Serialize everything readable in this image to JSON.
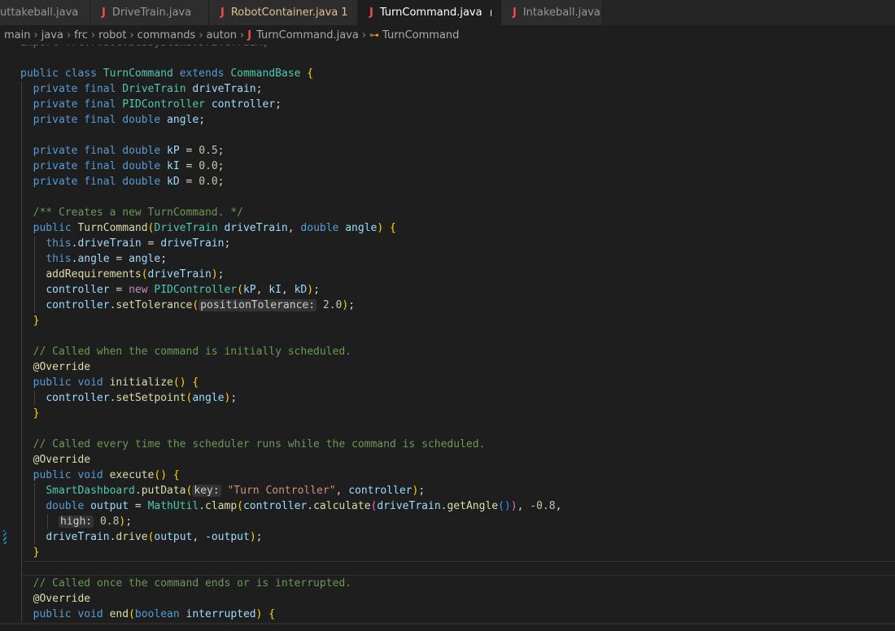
{
  "tabs": [
    {
      "label": "uttakeball.java",
      "icon": "java-icon",
      "active": false,
      "modified": false
    },
    {
      "label": "DriveTrain.java",
      "icon": "java-icon",
      "active": false,
      "modified": false
    },
    {
      "label": "RobotContainer.java",
      "icon": "java-icon",
      "active": false,
      "modified": true,
      "badge": "1"
    },
    {
      "label": "TurnCommand.java",
      "icon": "java-icon",
      "active": true,
      "modified": true
    },
    {
      "label": "Intakeball.java",
      "icon": "java-icon",
      "active": false,
      "modified": false
    }
  ],
  "breadcrumb": [
    "main",
    "java",
    "frc",
    "robot",
    "commands",
    "auton",
    "TurnCommand.java",
    "TurnCommand"
  ],
  "colors": {
    "editor_bg": "#1e1e1e",
    "tab_bg": "#2d2d2d",
    "keyword": "#569cd6",
    "type": "#4ec9b0",
    "function": "#dcdcaa",
    "variable": "#9cdcfe",
    "number": "#b5cea8",
    "string": "#ce9178",
    "comment": "#6a9955",
    "java_icon": "#f14c4c",
    "modified": "#e2c08d"
  },
  "code": {
    "partial_top": "import frc.robot.subsystems.DriveTrain;",
    "lines": [
      "public class TurnCommand extends CommandBase {",
      "  private final DriveTrain driveTrain;",
      "  private final PIDController controller;",
      "  private final double angle;",
      "",
      "  private final double kP = 0.5;",
      "  private final double kI = 0.0;",
      "  private final double kD = 0.0;",
      "",
      "  /** Creates a new TurnCommand. */",
      "  public TurnCommand(DriveTrain driveTrain, double angle) {",
      "    this.driveTrain = driveTrain;",
      "    this.angle = angle;",
      "    addRequirements(driveTrain);",
      "    controller = new PIDController(kP, kI, kD);",
      "    controller.setTolerance(positionTolerance: 2.0);",
      "  }",
      "",
      "  // Called when the command is initially scheduled.",
      "  @Override",
      "  public void initialize() {",
      "    controller.setSetpoint(angle);",
      "  }",
      "",
      "  // Called every time the scheduler runs while the command is scheduled.",
      "  @Override",
      "  public void execute() {",
      "    SmartDashboard.putData(key: \"Turn Controller\", controller);",
      "    double output = MathUtil.clamp(controller.calculate(driveTrain.getAngle()), -0.8,",
      "      high: 0.8);",
      "    driveTrain.drive(output, -output);",
      "  }",
      "",
      "  // Called once the command ends or is interrupted.",
      "  @Override",
      "  public void end(boolean interrupted) {"
    ]
  }
}
